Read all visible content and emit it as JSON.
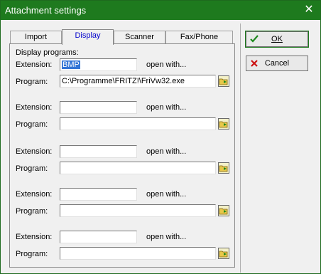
{
  "window": {
    "title": "Attachment settings"
  },
  "tabs": [
    {
      "label": "Import"
    },
    {
      "label": "Display"
    },
    {
      "label": "Scanner"
    },
    {
      "label": "Fax/Phone"
    }
  ],
  "section_title": "Display programs:",
  "extension_label": "Extension:",
  "program_label": "Program:",
  "open_with_label": "open with...",
  "rows": [
    {
      "extension": "BMP",
      "program": "C:\\Programme\\FRITZ!\\FriVw32.exe"
    },
    {
      "extension": "",
      "program": ""
    },
    {
      "extension": "",
      "program": ""
    },
    {
      "extension": "",
      "program": ""
    },
    {
      "extension": "",
      "program": ""
    }
  ],
  "buttons": {
    "ok": "OK",
    "cancel": "Cancel"
  },
  "icons": {
    "ok": "check-icon",
    "cancel": "x-icon",
    "browse": "folder-browse-icon"
  },
  "colors": {
    "titlebar": "#1e7a1e",
    "selection": "#3375d6",
    "active_tab_text": "#0000cc"
  }
}
